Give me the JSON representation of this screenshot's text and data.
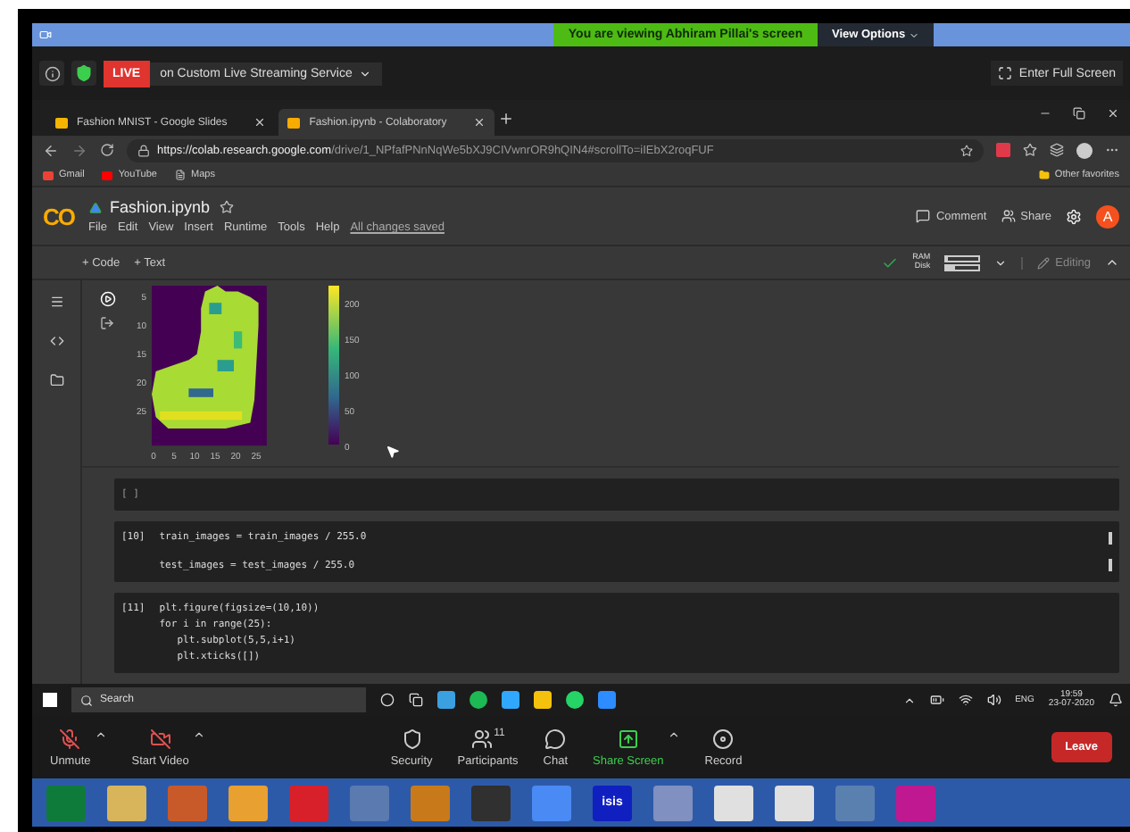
{
  "zoom_banner": {
    "viewing": "You are viewing Abhiram Pillai's screen",
    "view_options": "View Options"
  },
  "meeting_bar": {
    "live": "LIVE",
    "streaming": "on Custom Live Streaming Service",
    "fullscreen": "Enter Full Screen"
  },
  "browser": {
    "tabs": [
      {
        "label": "Fashion MNIST - Google Slides",
        "selected": false
      },
      {
        "label": "Fashion.ipynb - Colaboratory",
        "selected": true
      }
    ],
    "url_host": "https://colab.research.google.com",
    "url_path": "/drive/1_NPfafPNnNqWe5bXJ9CIVwnrOR9hQIN4#scrollTo=iIEbX2roqFUF",
    "bookmarks": [
      "Gmail",
      "YouTube",
      "Maps"
    ],
    "other_favorites": "Other favorites"
  },
  "colab": {
    "logo": "CO",
    "title": "Fashion.ipynb",
    "menu": [
      "File",
      "Edit",
      "View",
      "Insert",
      "Runtime",
      "Tools",
      "Help"
    ],
    "saved": "All changes saved",
    "comment": "Comment",
    "share": "Share",
    "avatar": "A",
    "toolbar": {
      "code": "+ Code",
      "text": "+ Text",
      "ram": {
        "label": "RAM",
        "level": 0.05
      },
      "disk": {
        "label": "Disk",
        "level": 0.25
      },
      "editing": "Editing"
    }
  },
  "plot": {
    "yticks": [
      "5",
      "10",
      "15",
      "20",
      "25"
    ],
    "xticks": [
      "0",
      "5",
      "10",
      "15",
      "20",
      "25"
    ],
    "colorbar_ticks": [
      "200",
      "150",
      "100",
      "50",
      "0"
    ]
  },
  "cells": [
    {
      "kind": "empty",
      "prompt": "[ ]"
    },
    {
      "kind": "code",
      "prompt": "[10]",
      "lines": [
        {
          "text": "train_images = train_images / 255.0"
        },
        {
          "text": "test_images = test_images / 255.0"
        }
      ]
    },
    {
      "kind": "code",
      "prompt": "[11]",
      "lines": [
        {
          "text": "plt.figure(figsize=(10,10))"
        },
        {
          "text": "for i in range(25):",
          "children": [
            {
              "text": "plt.subplot(5,5,i+1)"
            },
            {
              "text": "plt.xticks([])"
            }
          ]
        }
      ]
    }
  ],
  "shared_taskbar": {
    "search": "Search",
    "language": "ENG",
    "time": "19:59",
    "date": "23-07-2020"
  },
  "zoom_controls": [
    {
      "kind": "mic",
      "label": "Unmute",
      "caret": true
    },
    {
      "kind": "video",
      "label": "Start Video",
      "caret": true
    },
    {
      "kind": "security",
      "label": "Security",
      "caret": false
    },
    {
      "kind": "participants",
      "label": "Participants",
      "count": "11",
      "caret": false
    },
    {
      "kind": "chat",
      "label": "Chat",
      "caret": false
    },
    {
      "kind": "share",
      "label": "Share Screen",
      "caret": true
    },
    {
      "kind": "record",
      "label": "Record",
      "caret": false
    }
  ],
  "leave": "Leave",
  "local_taskbar": {
    "app_label": "isis"
  }
}
